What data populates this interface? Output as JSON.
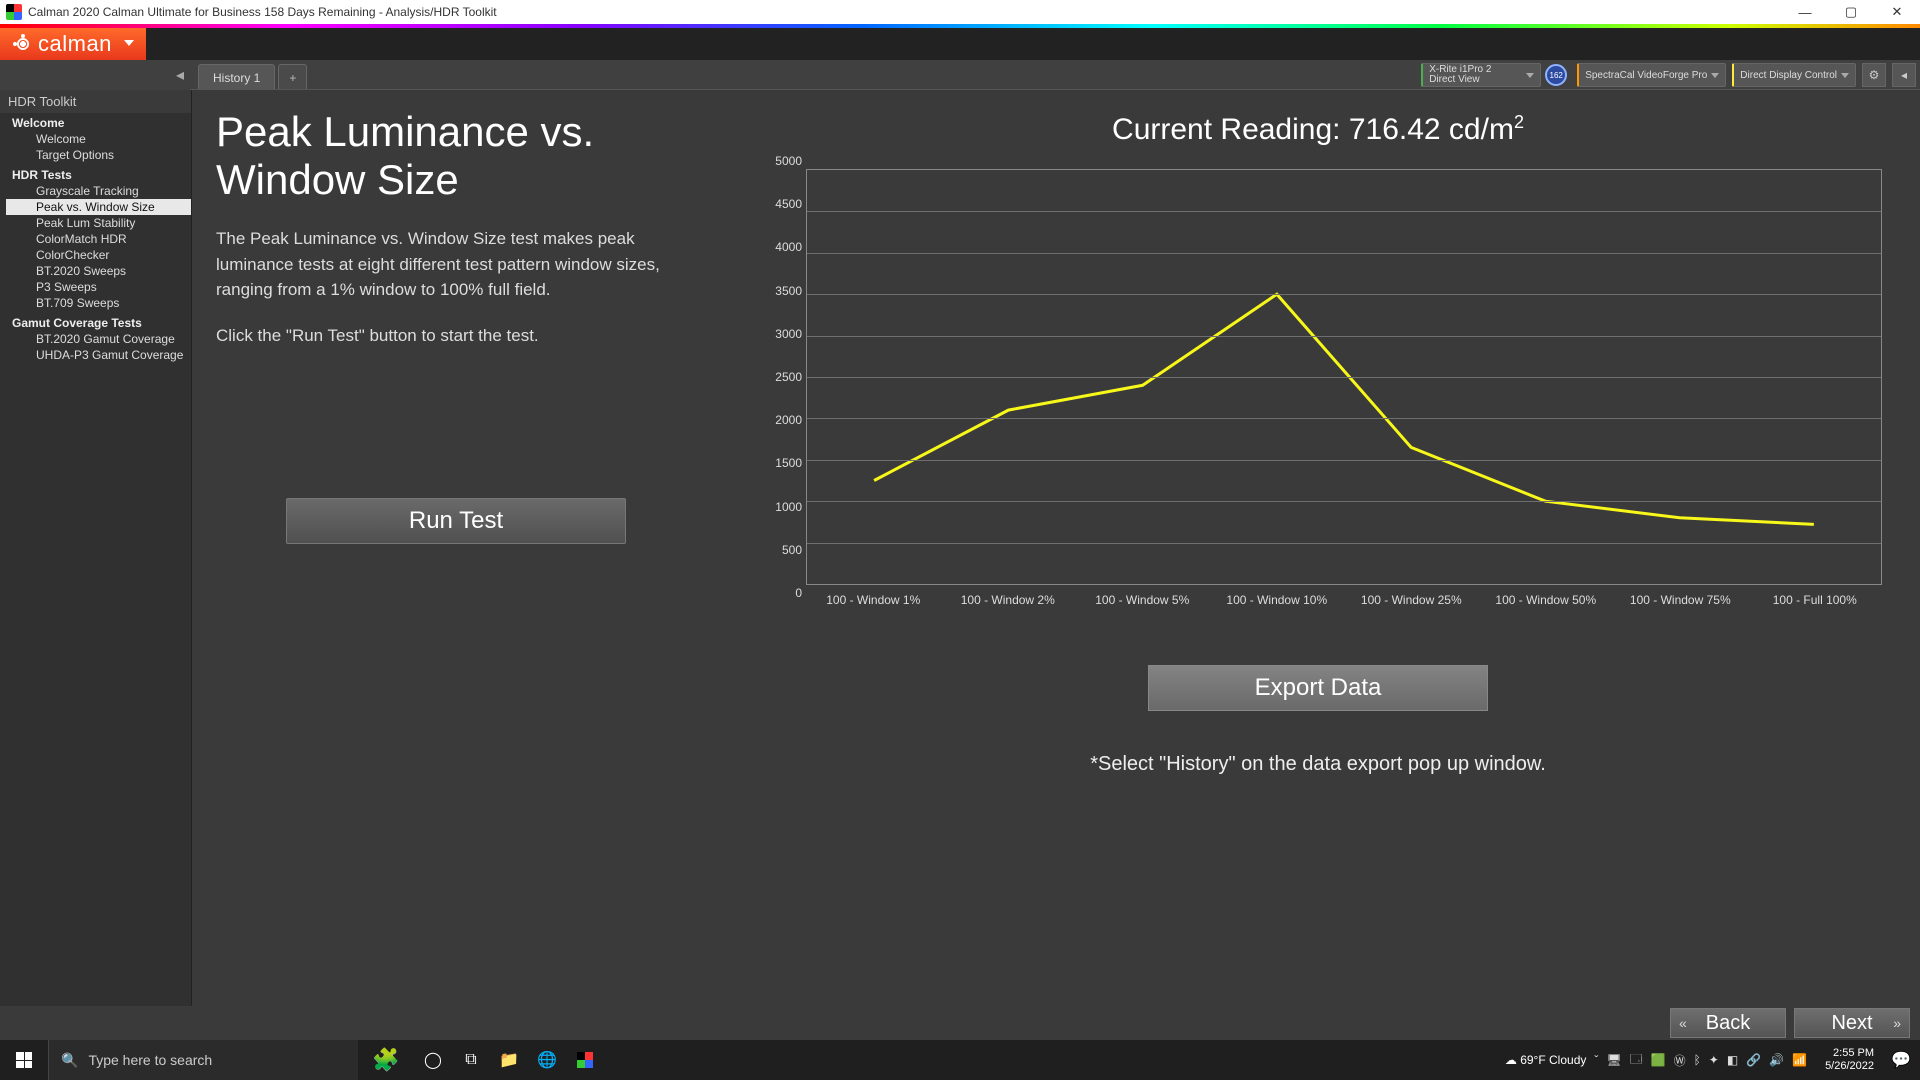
{
  "window": {
    "title": "Calman 2020 Calman Ultimate for Business 158 Days Remaining - Analysis/HDR Toolkit"
  },
  "brand": {
    "name": "calman"
  },
  "tabs": {
    "history": "History 1"
  },
  "tools": {
    "meter_line1": "X-Rite i1Pro 2",
    "meter_line2": "Direct View",
    "badge": "162",
    "source": "SpectraCal VideoForge Pro",
    "display": "Direct Display Control"
  },
  "sidebar": {
    "header": "HDR Toolkit",
    "groups": [
      {
        "title": "Welcome",
        "items": [
          "Welcome",
          "Target Options"
        ]
      },
      {
        "title": "HDR Tests",
        "items": [
          "Grayscale Tracking",
          "Peak vs. Window Size",
          "Peak Lum Stability",
          "ColorMatch HDR",
          "ColorChecker",
          "BT.2020 Sweeps",
          "P3 Sweeps",
          "BT.709 Sweeps"
        ]
      },
      {
        "title": "Gamut Coverage Tests",
        "items": [
          "BT.2020 Gamut Coverage",
          "UHDA-P3 Gamut Coverage"
        ]
      }
    ],
    "active": "Peak vs. Window Size"
  },
  "page": {
    "title": "Peak Luminance vs. Window Size",
    "desc1": "The Peak Luminance vs. Window Size test makes peak luminance tests at eight different test pattern window sizes, ranging from a 1% window to 100% full field.",
    "desc2": "Click the \"Run Test\" button to start the test.",
    "run": "Run Test",
    "reading_label": "Current Reading: ",
    "reading_value": "716.42 cd/m",
    "export": "Export  Data",
    "hint": "*Select \"History\" on the data export pop up window."
  },
  "nav": {
    "back": "Back",
    "next": "Next"
  },
  "taskbar": {
    "search_placeholder": "Type here to search",
    "weather": "69°F  Cloudy",
    "time": "2:55 PM",
    "date": "5/26/2022"
  },
  "chart_data": {
    "type": "line",
    "title": "Peak Luminance vs. Window Size",
    "xlabel": "",
    "ylabel": "",
    "ylim": [
      0,
      5000
    ],
    "yticks": [
      0,
      500,
      1000,
      1500,
      2000,
      2500,
      3000,
      3500,
      4000,
      4500,
      5000
    ],
    "categories": [
      "100 - Window  1%",
      "100 - Window  2%",
      "100 - Window  5%",
      "100 - Window 10%",
      "100 - Window 25%",
      "100 - Window 50%",
      "100 - Window 75%",
      "100 - Full  100%"
    ],
    "values": [
      1250,
      2100,
      2400,
      3500,
      1650,
      1000,
      800,
      720
    ],
    "series_color": "#f7f71a"
  }
}
